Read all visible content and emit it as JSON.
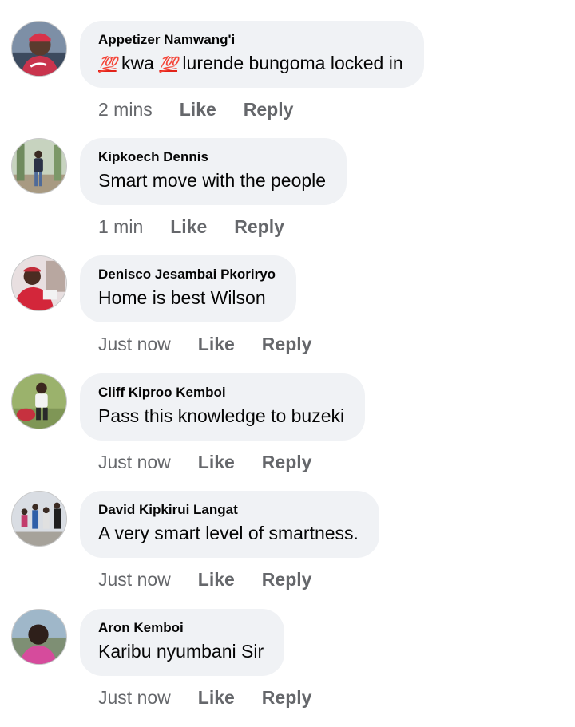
{
  "comments": [
    {
      "author": "Appetizer Namwang'i",
      "text_parts": [
        "💯",
        " kwa ",
        "💯",
        " lurende bungoma locked in"
      ],
      "time": "2 mins",
      "like": "Like",
      "reply": "Reply"
    },
    {
      "author": "Kipkoech Dennis",
      "text": "Smart move with the people",
      "time": "1 min",
      "like": "Like",
      "reply": "Reply"
    },
    {
      "author": "Denisco Jesambai Pkoriryo",
      "text": "Home is best Wilson",
      "time": "Just now",
      "like": "Like",
      "reply": "Reply"
    },
    {
      "author": "Cliff Kiproo Kemboi",
      "text": "Pass this knowledge to buzeki",
      "time": "Just now",
      "like": "Like",
      "reply": "Reply"
    },
    {
      "author": "David Kipkirui Langat",
      "text": "A very smart level of smartness.",
      "time": "Just now",
      "like": "Like",
      "reply": "Reply"
    },
    {
      "author": "Aron Kemboi",
      "text": "Karibu nyumbani Sir",
      "time": "Just now",
      "like": "Like",
      "reply": "Reply"
    }
  ]
}
